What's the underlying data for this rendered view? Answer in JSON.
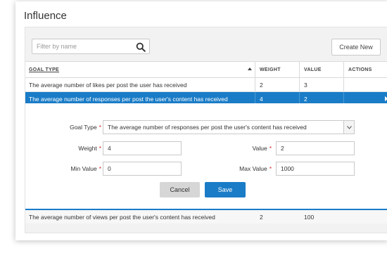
{
  "title": "Influence",
  "search": {
    "placeholder": "Filter by name"
  },
  "create_label": "Create New",
  "table": {
    "headers": {
      "goal_type": "GOAL TYPE",
      "weight": "WEIGHT",
      "value": "VALUE",
      "actions": "ACTIONS"
    },
    "rows": [
      {
        "goal_type": "The average number of likes per post the user has received",
        "weight": "2",
        "value": "3"
      },
      {
        "goal_type": "The average number of responses per post the user's content has received",
        "weight": "4",
        "value": "2"
      }
    ],
    "after_rows": [
      {
        "goal_type": "The average number of views per post the user's content has received",
        "weight": "2",
        "value": "100"
      }
    ]
  },
  "form": {
    "goal_type_label": "Goal Type",
    "goal_type_value": "The average number of responses per post the user's content has received",
    "weight_label": "Weight",
    "weight_value": "4",
    "value_label": "Value",
    "value_value": "2",
    "min_label": "Min Value",
    "min_value": "0",
    "max_label": "Max Value",
    "max_value": "1000",
    "required_mark": "*",
    "cancel_label": "Cancel",
    "save_label": "Save"
  },
  "colors": {
    "accent": "#1a7cc7",
    "required": "#d9262a"
  }
}
